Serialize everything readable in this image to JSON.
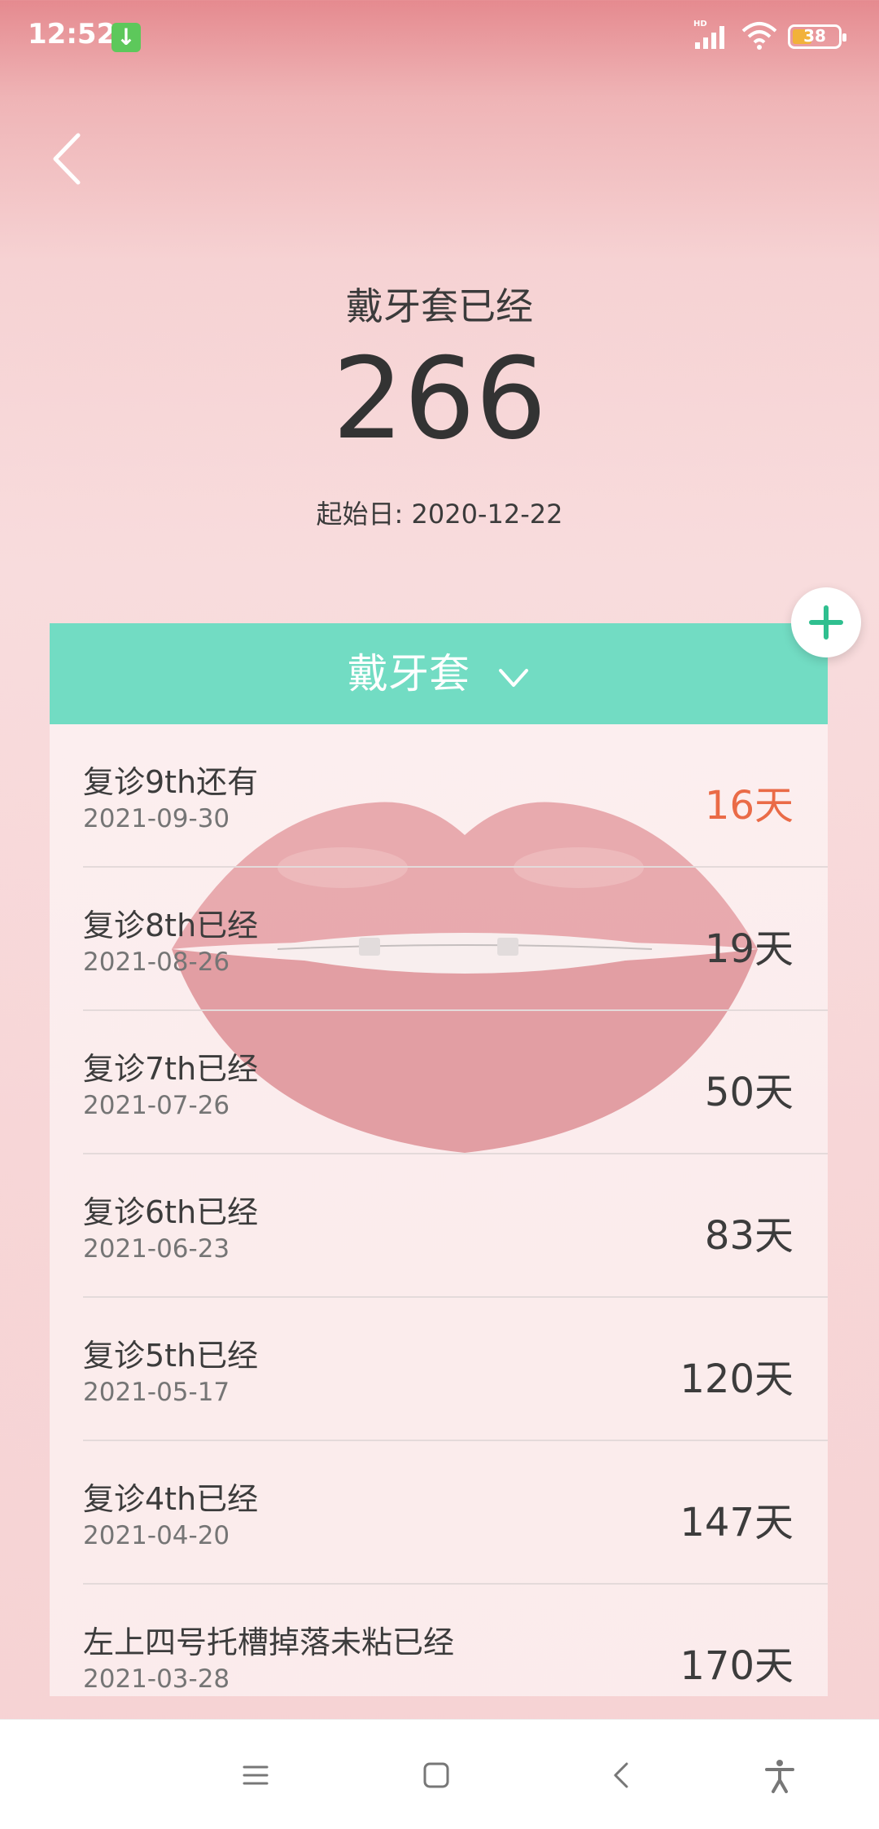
{
  "status_bar": {
    "time": "12:52",
    "battery": "38",
    "download_glyph": "↓"
  },
  "header": {
    "title": "戴牙套已经",
    "count": "266",
    "start_date": "起始日: 2020-12-22"
  },
  "card": {
    "category_label": "戴牙套"
  },
  "items": [
    {
      "name": "复诊9th还有",
      "date": "2021-09-30",
      "days": "16天",
      "highlight": true
    },
    {
      "name": "复诊8th已经",
      "date": "2021-08-26",
      "days": "19天"
    },
    {
      "name": "复诊7th已经",
      "date": "2021-07-26",
      "days": "50天"
    },
    {
      "name": "复诊6th已经",
      "date": "2021-06-23",
      "days": "83天"
    },
    {
      "name": "复诊5th已经",
      "date": "2021-05-17",
      "days": "120天"
    },
    {
      "name": "复诊4th已经",
      "date": "2021-04-20",
      "days": "147天"
    },
    {
      "name": "左上四号托槽掉落未粘已经",
      "date": "2021-03-28",
      "days": "170天"
    }
  ],
  "colors": {
    "accent": "#72dcc3",
    "highlight": "#ea6b47",
    "fab_plus": "#2fbf8f"
  },
  "icons": [
    "back-icon",
    "chevron-down-icon",
    "plus-icon",
    "menu-icon",
    "home-icon",
    "nav-back-icon",
    "accessibility-icon"
  ]
}
